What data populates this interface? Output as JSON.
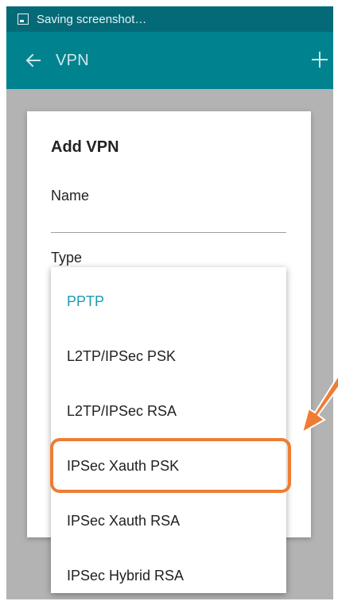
{
  "status_bar": {
    "text": "Saving screenshot…",
    "icon": "screenshot-icon"
  },
  "app_bar": {
    "title": "VPN",
    "back_icon": "arrow-left-icon",
    "add_icon": "plus-icon"
  },
  "dialog": {
    "title": "Add VPN",
    "name_label": "Name",
    "type_label": "Type"
  },
  "dropdown": {
    "options": [
      {
        "label": "PPTP",
        "selected": true
      },
      {
        "label": "L2TP/IPSec PSK",
        "selected": false
      },
      {
        "label": "L2TP/IPSec RSA",
        "selected": false
      },
      {
        "label": "IPSec Xauth PSK",
        "selected": false
      },
      {
        "label": "IPSec Xauth RSA",
        "selected": false
      },
      {
        "label": "IPSec Hybrid RSA",
        "selected": false
      }
    ]
  },
  "annotation": {
    "highlighted_option": "IPSec Xauth PSK",
    "color": "#ee7d33"
  },
  "colors": {
    "status_bar": "#056a78",
    "app_bar": "#00838f",
    "selected_text": "#1e9bb0",
    "scrim": "#b3b3b3"
  }
}
